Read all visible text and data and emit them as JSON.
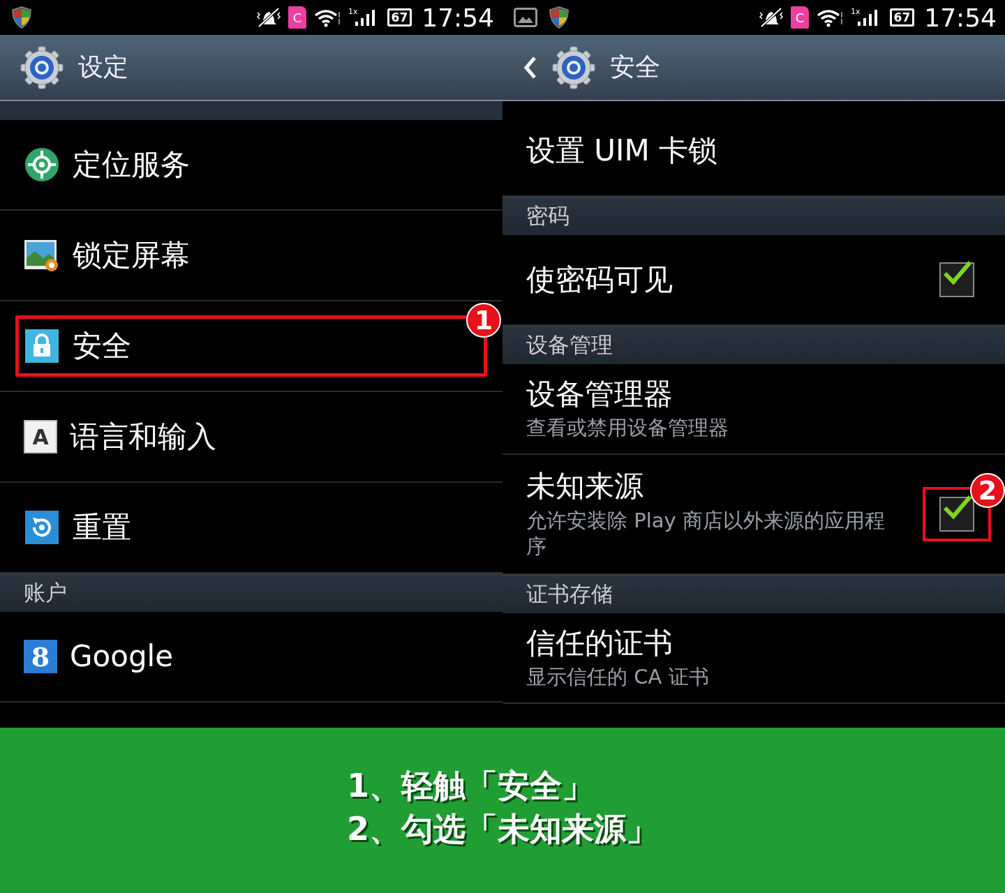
{
  "panels": [
    {
      "status_bar": {
        "network": "1x",
        "battery": "67",
        "carrier_badge": "C",
        "time": "17:54"
      },
      "action_bar": {
        "title": "设定",
        "back": false
      },
      "rows": [
        {
          "kind": "cut"
        },
        {
          "kind": "icon-entry",
          "title": "定位服务"
        },
        {
          "kind": "icon-entry",
          "title": "锁定屏幕"
        },
        {
          "kind": "icon-entry",
          "title": "安全",
          "highlighted": true,
          "marker": "1"
        },
        {
          "kind": "icon-entry",
          "icon_text": "A",
          "title": "语言和输入"
        },
        {
          "kind": "icon-entry",
          "title": "重置"
        },
        {
          "kind": "section",
          "title": "账户"
        },
        {
          "kind": "icon-entry",
          "icon_text": "8",
          "title": "Google"
        }
      ]
    },
    {
      "status_bar": {
        "network": "1x",
        "battery": "67",
        "carrier_badge": "C",
        "time": "17:54"
      },
      "action_bar": {
        "title": "安全",
        "back": true
      },
      "rows": [
        {
          "kind": "gap"
        },
        {
          "kind": "entry",
          "title": "设置 UIM 卡锁"
        },
        {
          "kind": "section",
          "title": "密码"
        },
        {
          "kind": "entry",
          "title": "使密码可见",
          "checked": true
        },
        {
          "kind": "section",
          "title": "设备管理"
        },
        {
          "kind": "entry",
          "title": "设备管理器",
          "subtitle": "查看或禁用设备管理器"
        },
        {
          "kind": "entry",
          "title": "未知来源",
          "subtitle": "允许安装除 Play 商店以外来源的应用程序",
          "checked": true,
          "marker": "2"
        },
        {
          "kind": "section",
          "title": "证书存储"
        },
        {
          "kind": "entry",
          "title": "信任的证书",
          "subtitle": "显示信任的 CA 证书"
        }
      ]
    }
  ],
  "caption": {
    "lines": [
      "1、轻触「安全」",
      "2、勾选「未知来源」"
    ]
  }
}
